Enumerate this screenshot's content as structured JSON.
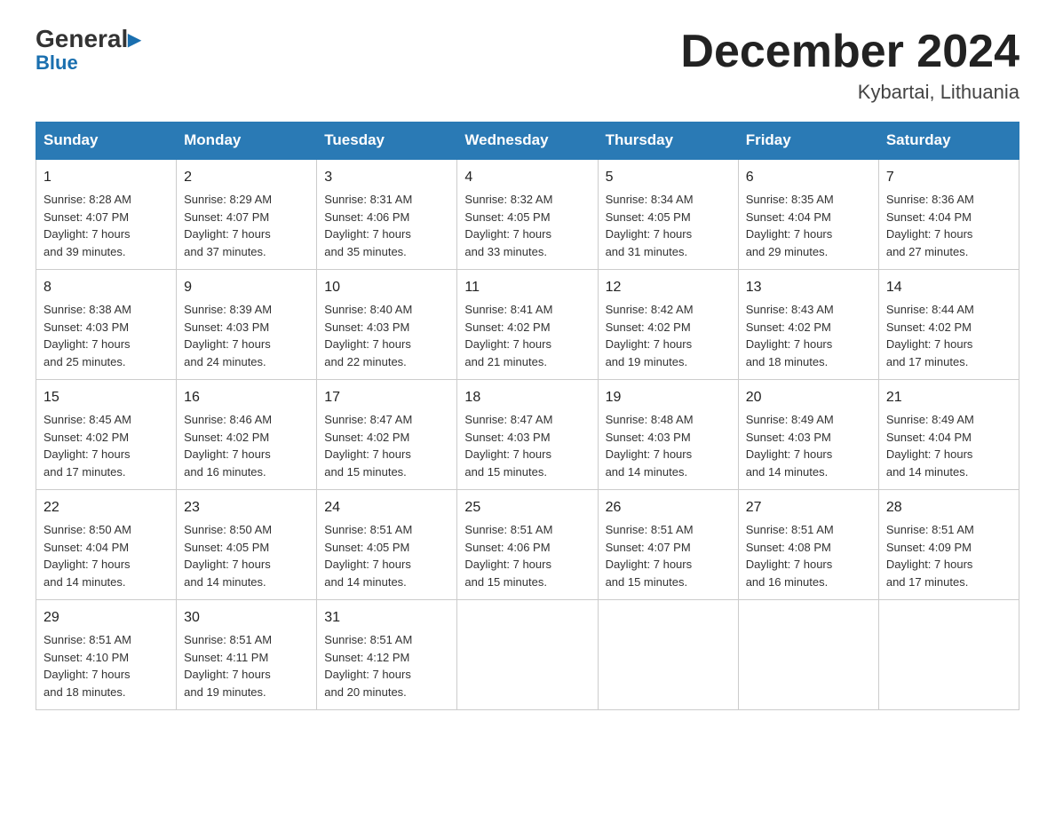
{
  "header": {
    "logo_general": "General",
    "logo_blue": "Blue",
    "month_title": "December 2024",
    "location": "Kybartai, Lithuania"
  },
  "weekdays": [
    "Sunday",
    "Monday",
    "Tuesday",
    "Wednesday",
    "Thursday",
    "Friday",
    "Saturday"
  ],
  "weeks": [
    [
      {
        "day": "1",
        "sunrise": "8:28 AM",
        "sunset": "4:07 PM",
        "daylight": "7 hours and 39 minutes."
      },
      {
        "day": "2",
        "sunrise": "8:29 AM",
        "sunset": "4:07 PM",
        "daylight": "7 hours and 37 minutes."
      },
      {
        "day": "3",
        "sunrise": "8:31 AM",
        "sunset": "4:06 PM",
        "daylight": "7 hours and 35 minutes."
      },
      {
        "day": "4",
        "sunrise": "8:32 AM",
        "sunset": "4:05 PM",
        "daylight": "7 hours and 33 minutes."
      },
      {
        "day": "5",
        "sunrise": "8:34 AM",
        "sunset": "4:05 PM",
        "daylight": "7 hours and 31 minutes."
      },
      {
        "day": "6",
        "sunrise": "8:35 AM",
        "sunset": "4:04 PM",
        "daylight": "7 hours and 29 minutes."
      },
      {
        "day": "7",
        "sunrise": "8:36 AM",
        "sunset": "4:04 PM",
        "daylight": "7 hours and 27 minutes."
      }
    ],
    [
      {
        "day": "8",
        "sunrise": "8:38 AM",
        "sunset": "4:03 PM",
        "daylight": "7 hours and 25 minutes."
      },
      {
        "day": "9",
        "sunrise": "8:39 AM",
        "sunset": "4:03 PM",
        "daylight": "7 hours and 24 minutes."
      },
      {
        "day": "10",
        "sunrise": "8:40 AM",
        "sunset": "4:03 PM",
        "daylight": "7 hours and 22 minutes."
      },
      {
        "day": "11",
        "sunrise": "8:41 AM",
        "sunset": "4:02 PM",
        "daylight": "7 hours and 21 minutes."
      },
      {
        "day": "12",
        "sunrise": "8:42 AM",
        "sunset": "4:02 PM",
        "daylight": "7 hours and 19 minutes."
      },
      {
        "day": "13",
        "sunrise": "8:43 AM",
        "sunset": "4:02 PM",
        "daylight": "7 hours and 18 minutes."
      },
      {
        "day": "14",
        "sunrise": "8:44 AM",
        "sunset": "4:02 PM",
        "daylight": "7 hours and 17 minutes."
      }
    ],
    [
      {
        "day": "15",
        "sunrise": "8:45 AM",
        "sunset": "4:02 PM",
        "daylight": "7 hours and 17 minutes."
      },
      {
        "day": "16",
        "sunrise": "8:46 AM",
        "sunset": "4:02 PM",
        "daylight": "7 hours and 16 minutes."
      },
      {
        "day": "17",
        "sunrise": "8:47 AM",
        "sunset": "4:02 PM",
        "daylight": "7 hours and 15 minutes."
      },
      {
        "day": "18",
        "sunrise": "8:47 AM",
        "sunset": "4:03 PM",
        "daylight": "7 hours and 15 minutes."
      },
      {
        "day": "19",
        "sunrise": "8:48 AM",
        "sunset": "4:03 PM",
        "daylight": "7 hours and 14 minutes."
      },
      {
        "day": "20",
        "sunrise": "8:49 AM",
        "sunset": "4:03 PM",
        "daylight": "7 hours and 14 minutes."
      },
      {
        "day": "21",
        "sunrise": "8:49 AM",
        "sunset": "4:04 PM",
        "daylight": "7 hours and 14 minutes."
      }
    ],
    [
      {
        "day": "22",
        "sunrise": "8:50 AM",
        "sunset": "4:04 PM",
        "daylight": "7 hours and 14 minutes."
      },
      {
        "day": "23",
        "sunrise": "8:50 AM",
        "sunset": "4:05 PM",
        "daylight": "7 hours and 14 minutes."
      },
      {
        "day": "24",
        "sunrise": "8:51 AM",
        "sunset": "4:05 PM",
        "daylight": "7 hours and 14 minutes."
      },
      {
        "day": "25",
        "sunrise": "8:51 AM",
        "sunset": "4:06 PM",
        "daylight": "7 hours and 15 minutes."
      },
      {
        "day": "26",
        "sunrise": "8:51 AM",
        "sunset": "4:07 PM",
        "daylight": "7 hours and 15 minutes."
      },
      {
        "day": "27",
        "sunrise": "8:51 AM",
        "sunset": "4:08 PM",
        "daylight": "7 hours and 16 minutes."
      },
      {
        "day": "28",
        "sunrise": "8:51 AM",
        "sunset": "4:09 PM",
        "daylight": "7 hours and 17 minutes."
      }
    ],
    [
      {
        "day": "29",
        "sunrise": "8:51 AM",
        "sunset": "4:10 PM",
        "daylight": "7 hours and 18 minutes."
      },
      {
        "day": "30",
        "sunrise": "8:51 AM",
        "sunset": "4:11 PM",
        "daylight": "7 hours and 19 minutes."
      },
      {
        "day": "31",
        "sunrise": "8:51 AM",
        "sunset": "4:12 PM",
        "daylight": "7 hours and 20 minutes."
      },
      null,
      null,
      null,
      null
    ]
  ],
  "labels": {
    "sunrise": "Sunrise:",
    "sunset": "Sunset:",
    "daylight": "Daylight:"
  }
}
